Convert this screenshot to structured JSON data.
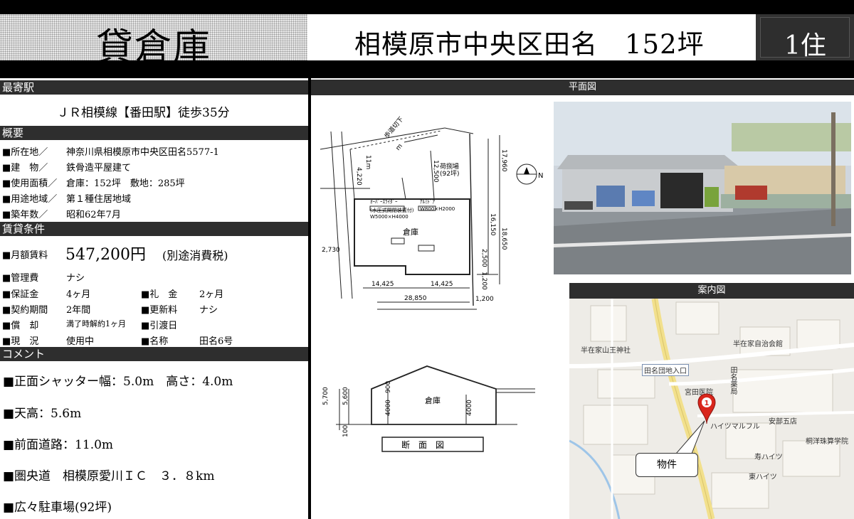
{
  "header": {
    "type_title": "貸倉庫",
    "location_title": "相模原市中央区田名　152坪",
    "zone_title": "1住"
  },
  "sections": {
    "station": "最寄駅",
    "summary": "概要",
    "rent_terms": "賃貸条件",
    "comment": "コメント",
    "floor_plan": "平面図",
    "area_map": "案内図"
  },
  "station": {
    "text": "ＪＲ相模線【番田駅】徒歩35分"
  },
  "summary": [
    {
      "label": "■所在地／",
      "value": "神奈川県相模原市中央区田名5577-1"
    },
    {
      "label": "■建　物／",
      "value": "鉄骨造平屋建て"
    },
    {
      "label": "■使用面積／",
      "value": "倉庫：152坪　敷地：285坪"
    },
    {
      "label": "■用途地域／",
      "value": "第１種住居地域"
    },
    {
      "label": "■築年数／",
      "value": "昭和62年7月"
    }
  ],
  "rent": {
    "monthly_label": "■月額賃料",
    "monthly_value": "547,200円",
    "monthly_tax": "(別途消費税)",
    "rows": [
      {
        "l1": "■管理費",
        "v1": "ナシ",
        "l2": "",
        "v2": ""
      },
      {
        "l1": "■保証金",
        "v1": "4ヶ月",
        "l2": "■礼　金",
        "v2": "2ヶ月"
      },
      {
        "l1": "■契約期間",
        "v1": "2年間",
        "l2": "■更新料",
        "v2": "ナシ"
      },
      {
        "l1": "■償　却",
        "v1": "満了時解約1ヶ月",
        "l2": "■引渡日",
        "v2": ""
      },
      {
        "l1": "■現　況",
        "v1": "使用中",
        "l2": "■名称",
        "v2": "田名6号"
      }
    ]
  },
  "comments": [
    "■正面シャッター幅：5.0m　高さ：4.0m",
    "■天高：5.6m",
    "■前面道路：11.0m",
    "■圏央道　相模原愛川ＩＣ　３．８km",
    "■広々駐車場(92坪)"
  ],
  "plan": {
    "warehouse": "倉庫",
    "parking": "荷捌場",
    "parking_area": "(92坪)",
    "shutter1_label": "ｵｰﾊﾞｰｽﾗｲﾀﾞｰ",
    "shutter1_note": "(水圧式開閉装置付)",
    "shutter1_size": "W5000×H4000",
    "shutter2_label": "ｱﾙﾐﾄﾞｱ",
    "shutter2_size": "W800×H2000",
    "sidewalk": "歩道切下",
    "sidewalk_len": "m",
    "road_width": "11m",
    "dim_top": "17,960",
    "dim_r1": "16,150",
    "dim_r2": "18,650",
    "dim_r3": "1,200",
    "dim_r4": "2,500",
    "dim_left": "2,730",
    "dim_lt": "4,220",
    "dim_mid": "12,500",
    "dim_b1": "14,425",
    "dim_b2": "14,425",
    "dim_total": "28,850",
    "dim_tail": "1,200",
    "north": "N"
  },
  "section": {
    "title": "断　面　図",
    "room": "倉庫",
    "h1": "5,700",
    "h2": "5,600",
    "h3": "4000",
    "h4": "900",
    "h5": "100",
    "h6": "4000"
  },
  "map": {
    "callout": "物件",
    "pin_number": "1",
    "labels": {
      "shrine": "半在家山王神社",
      "hall": "半在家自治会館",
      "junction": "田名団地入口",
      "clinic": "宮田医院",
      "pharmacy": "田名薬局",
      "building": "ハイツマルフル",
      "store": "安部五店",
      "school": "桐洋珠算学院",
      "heights1": "寿ハイツ",
      "heights2": "東ハイツ"
    }
  },
  "colors": {
    "section_bar": "#2e2e2e",
    "road": "#f2e08c",
    "pin": "#d9261c"
  }
}
